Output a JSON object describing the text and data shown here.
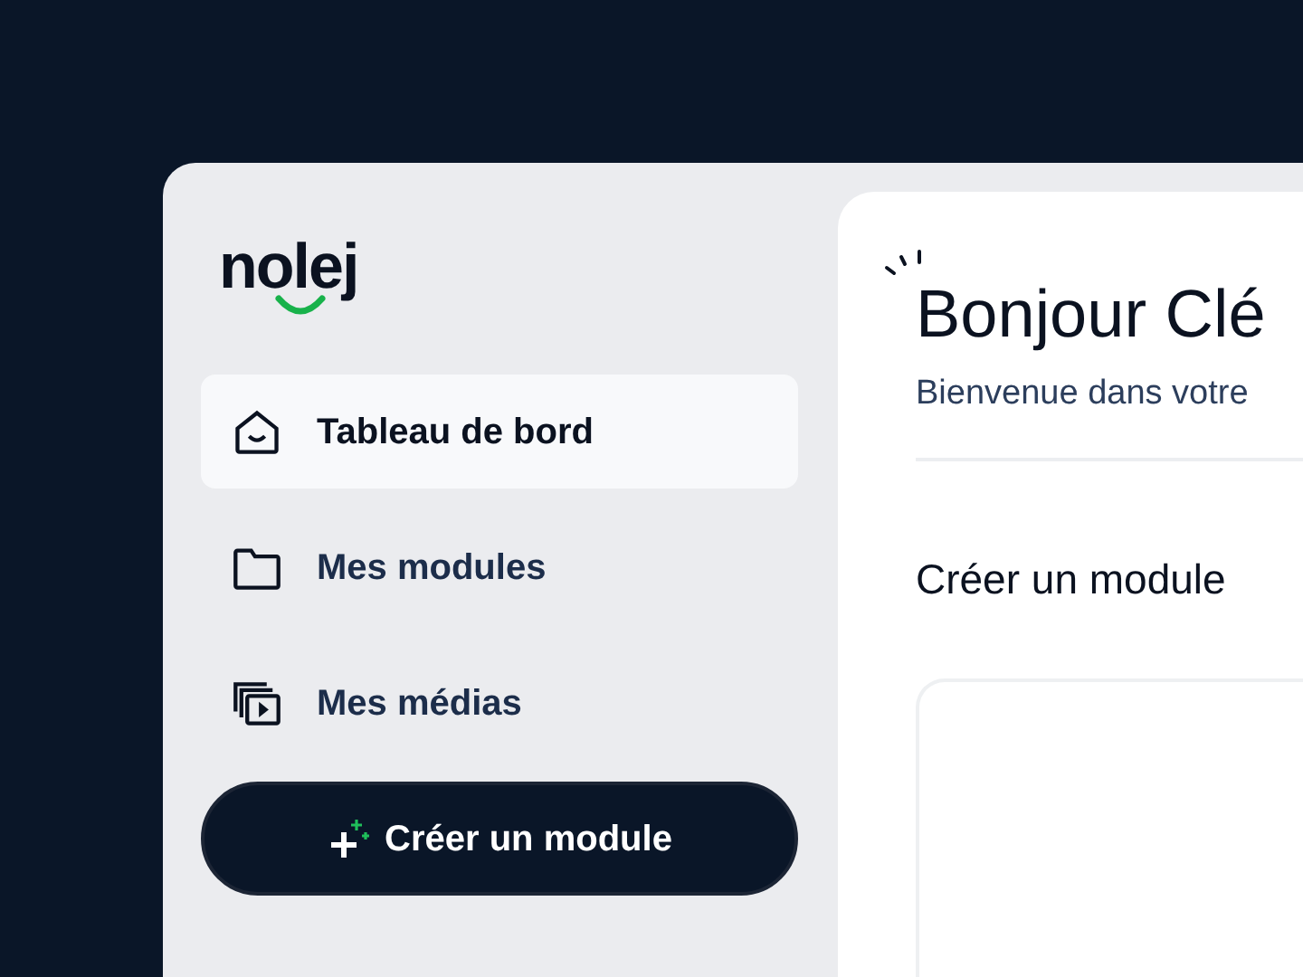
{
  "logo": "nolej",
  "sidebar": {
    "items": [
      {
        "kind": "home",
        "label": "Tableau de bord",
        "selected": true
      },
      {
        "kind": "folder",
        "label": "Mes modules",
        "selected": false
      },
      {
        "kind": "media",
        "label": "Mes médias",
        "selected": false
      }
    ],
    "create_button": "Créer un module"
  },
  "main": {
    "title": "Bonjour Clé",
    "subtitle": "Bienvenue dans votre",
    "section_title": "Créer un module"
  }
}
